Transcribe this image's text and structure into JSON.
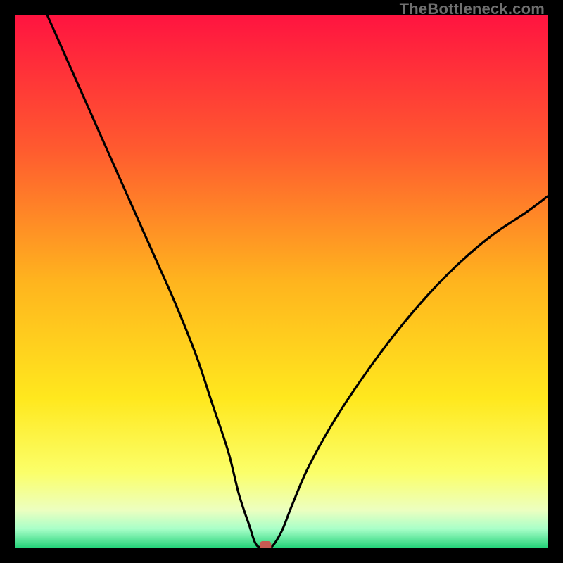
{
  "watermark": "TheBottleneck.com",
  "chart_data": {
    "type": "line",
    "title": "",
    "xlabel": "",
    "ylabel": "",
    "xlim": [
      0,
      100
    ],
    "ylim": [
      0,
      100
    ],
    "series": [
      {
        "name": "bottleneck-curve",
        "x": [
          6,
          10,
          14,
          18,
          22,
          26,
          30,
          34,
          37,
          40,
          42,
          44,
          45,
          46,
          48,
          50,
          52,
          55,
          60,
          66,
          72,
          78,
          84,
          90,
          96,
          100
        ],
        "y": [
          100,
          91,
          82,
          73,
          64,
          55,
          46,
          36,
          27,
          18,
          10,
          4,
          1,
          0,
          0,
          3,
          8,
          15,
          24,
          33,
          41,
          48,
          54,
          59,
          63,
          66
        ]
      }
    ],
    "minimum_marker": {
      "x": 47,
      "y": 0,
      "color": "#c75a52"
    },
    "gradient_stops": [
      {
        "offset": 0.0,
        "color": "#ff1440"
      },
      {
        "offset": 0.25,
        "color": "#ff5a2f"
      },
      {
        "offset": 0.5,
        "color": "#ffb41e"
      },
      {
        "offset": 0.72,
        "color": "#ffe81e"
      },
      {
        "offset": 0.86,
        "color": "#fbff6a"
      },
      {
        "offset": 0.93,
        "color": "#ecffc0"
      },
      {
        "offset": 0.965,
        "color": "#a8ffc8"
      },
      {
        "offset": 1.0,
        "color": "#26d37a"
      }
    ]
  }
}
